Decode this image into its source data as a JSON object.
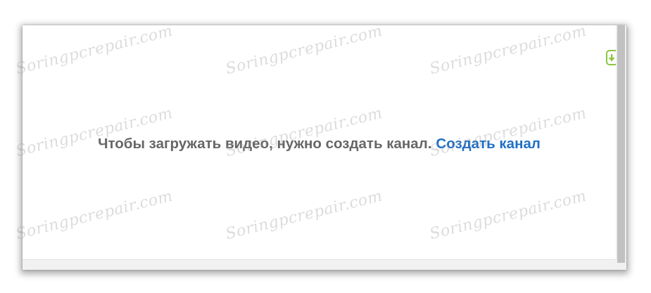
{
  "message": {
    "text": "Чтобы загружать видео, нужно создать канал.",
    "link_label": "Создать канал"
  },
  "icons": {
    "side_button": "upload-arrow-icon"
  },
  "colors": {
    "text": "#666666",
    "link": "#1e6fc7",
    "side_button_border": "#8dc63f",
    "scrollbar_thumb": "#c1c1c1"
  },
  "watermark": "Soringpcrepair.com"
}
